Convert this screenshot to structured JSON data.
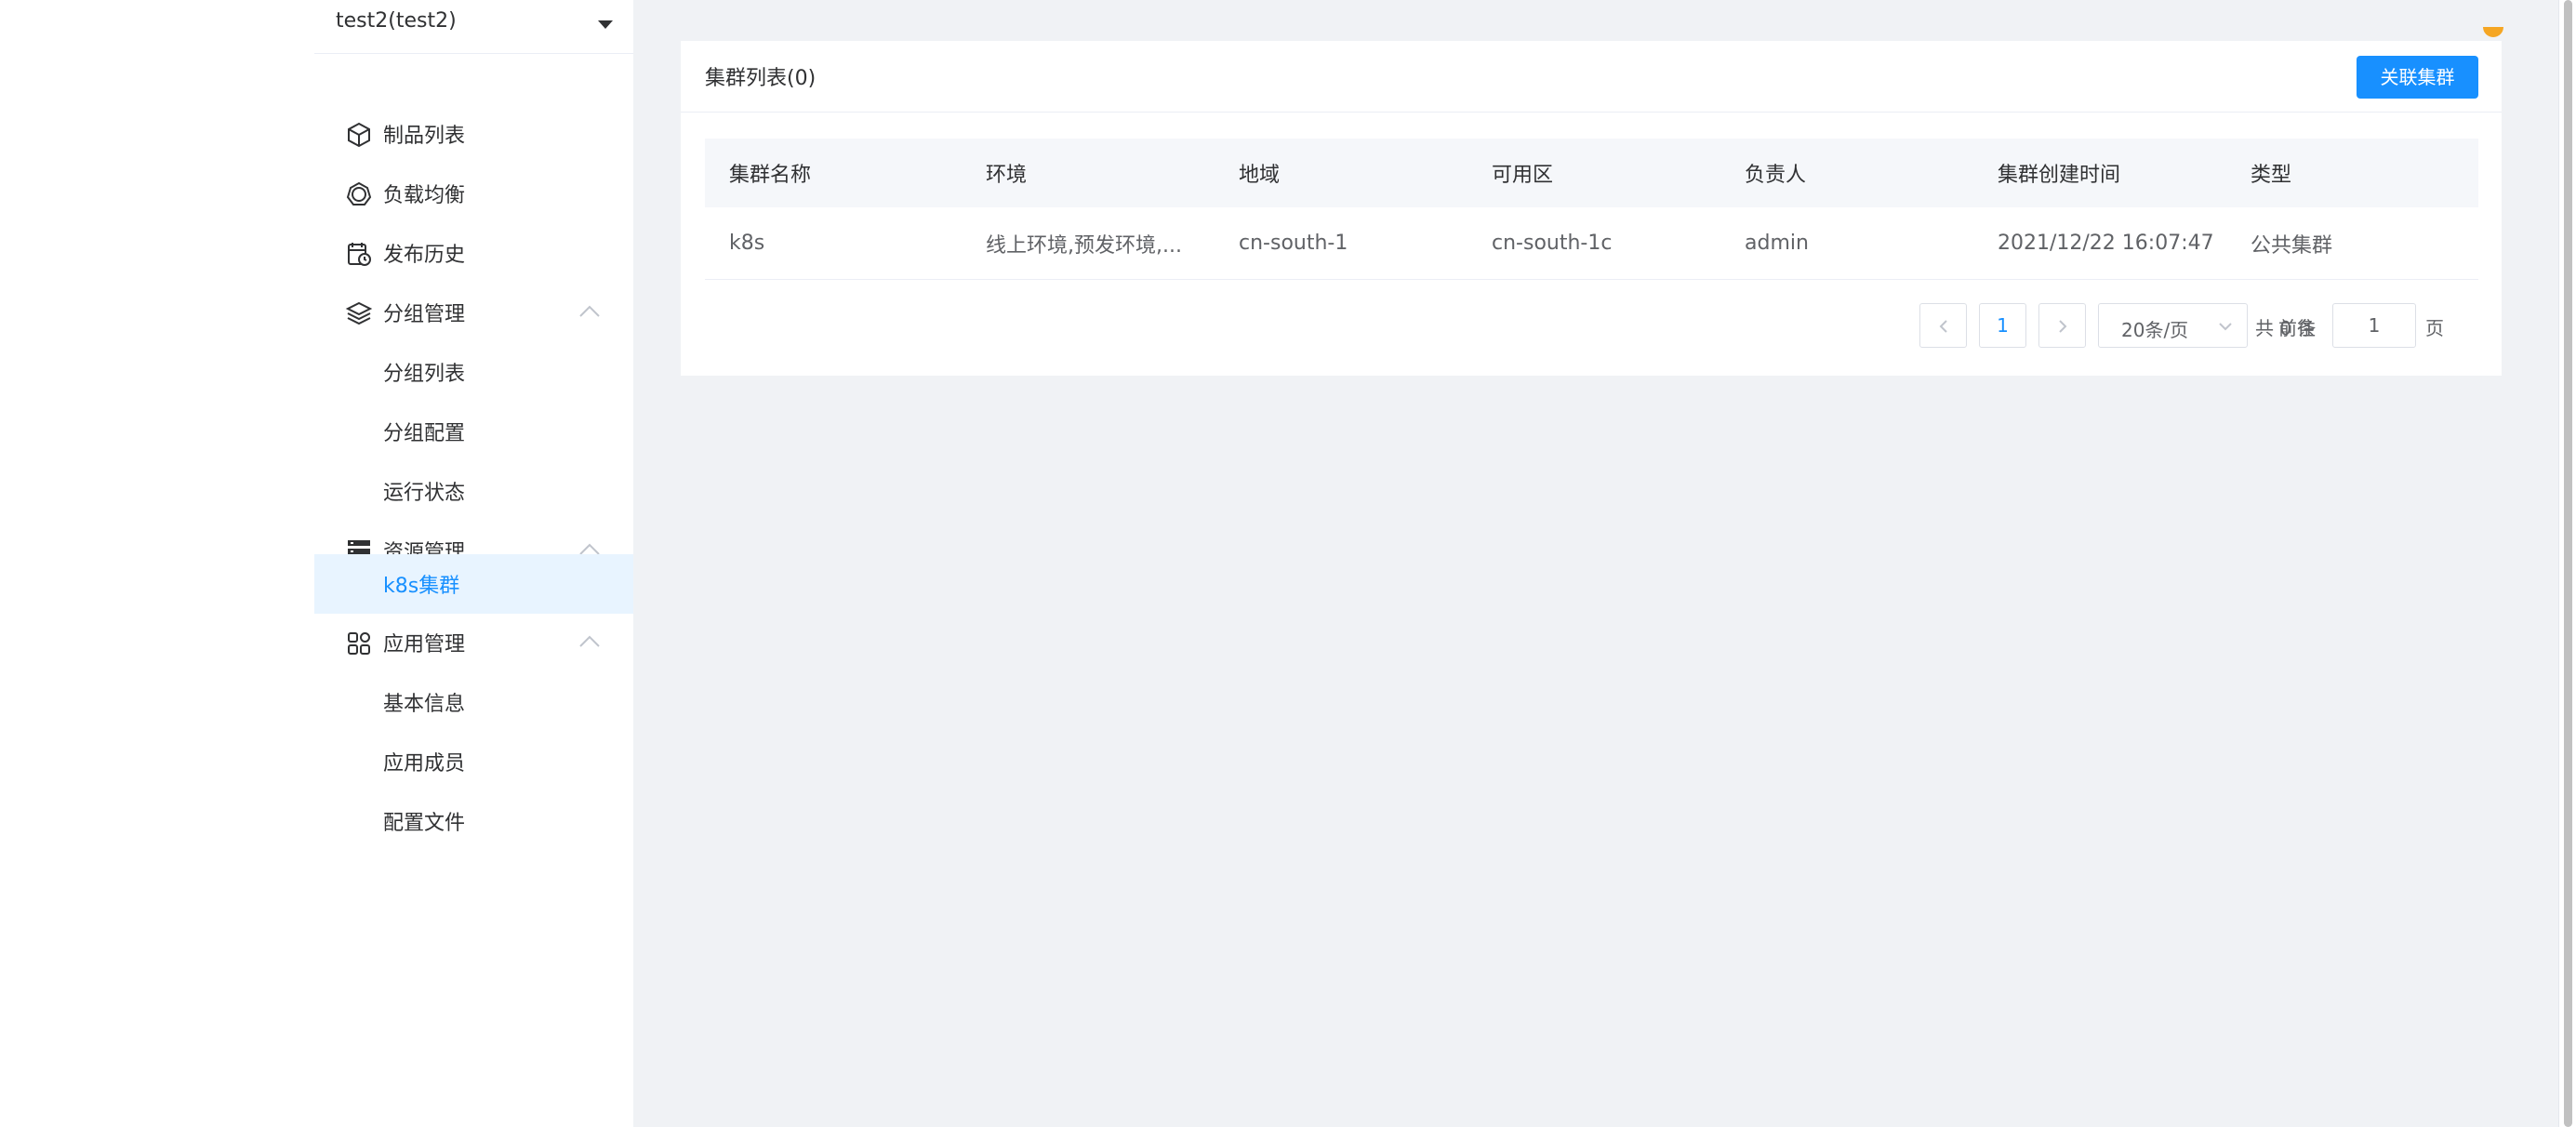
{
  "app_switcher": {
    "label": "test2(test2)"
  },
  "sidebar": {
    "items": [
      {
        "label": "制品列表",
        "icon": "cube-icon"
      },
      {
        "label": "负载均衡",
        "icon": "load-balance-icon"
      },
      {
        "label": "发布历史",
        "icon": "calendar-history-icon"
      },
      {
        "label": "分组管理",
        "icon": "layers-icon",
        "expanded": true
      },
      {
        "label": "分组列表"
      },
      {
        "label": "分组配置"
      },
      {
        "label": "运行状态"
      },
      {
        "label": "资源管理",
        "icon": "server-icon",
        "expanded": true
      },
      {
        "label": "k8s集群",
        "active": true
      },
      {
        "label": "应用管理",
        "icon": "grid-apps-icon",
        "expanded": true
      },
      {
        "label": "基本信息"
      },
      {
        "label": "应用成员"
      },
      {
        "label": "配置文件"
      }
    ]
  },
  "card": {
    "title": "集群列表(0)",
    "associate_button": "关联集群"
  },
  "table": {
    "columns": [
      "集群名称",
      "环境",
      "地域",
      "可用区",
      "负责人",
      "集群创建时间",
      "类型"
    ],
    "rows": [
      [
        "k8s",
        "线上环境,预发环境,...",
        "cn-south-1",
        "cn-south-1c",
        "admin",
        "2021/12/22 16:07:47",
        "公共集群"
      ]
    ]
  },
  "pagination": {
    "current_page": "1",
    "page_size": "20条/页",
    "total_text": "共 0 条",
    "goto_label": "前往",
    "goto_value": "1",
    "page_unit": "页"
  },
  "colors": {
    "accent": "#1890ff",
    "active_bg": "#e8f4ff",
    "main_bg": "#f0f2f5"
  }
}
